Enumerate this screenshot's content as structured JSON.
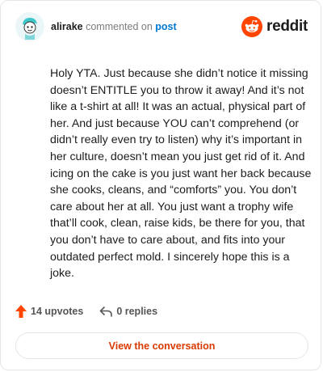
{
  "comment": {
    "author": "alirake",
    "action": "commented on",
    "target": "post",
    "text": "Holy YTA. Just because she didn’t notice it missing doesn’t ENTITLE you to throw it away! And it’s not like a t-shirt at all! It was an actual, physical part of her. And just because YOU can’t comprehend (or didn’t really even try to listen) why it’s important in her culture, doesn’t mean you just get rid of it. And icing on the cake is you just want her back because she cooks, cleans, and “comforts” you. You don’t care about her at all. You just want a trophy wife that’ll cook, clean, raise kids, be there for you, that you don’t have to care about, and fits into your outdated perfect mold. I sincerely hope this is a joke."
  },
  "brand": {
    "name": "reddit",
    "color": "#ff4500"
  },
  "footer": {
    "upvotes": "14 upvotes",
    "replies": "0 replies"
  },
  "cta": {
    "label": "View the conversation"
  },
  "colors": {
    "accent": "#d93a00",
    "link": "#0079d3",
    "upvote": "#ff4500"
  }
}
